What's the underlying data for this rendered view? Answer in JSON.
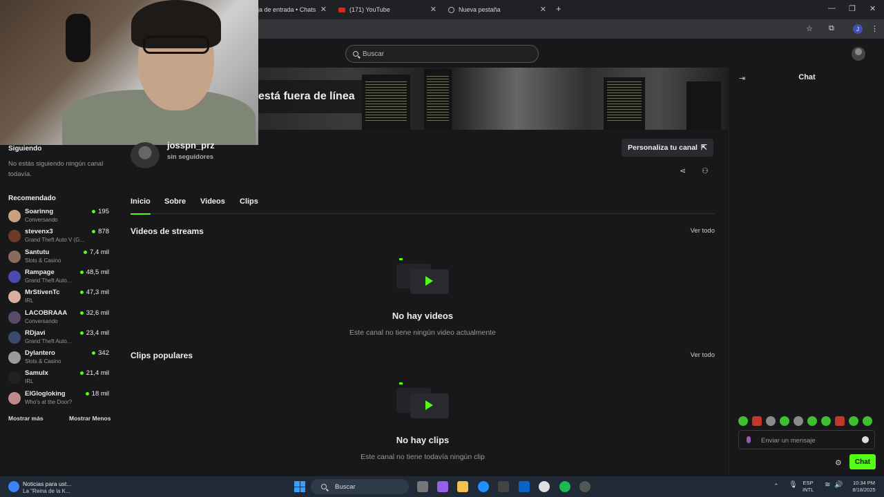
{
  "browser": {
    "tabs": [
      {
        "title": "ja de entrada • Chats"
      },
      {
        "title": "(171) YouTube"
      },
      {
        "title": "Nueva pestaña"
      }
    ],
    "tab_close": "✕",
    "new_tab": "+",
    "window_minimize": "—",
    "window_maximize": "❐",
    "window_close": "✕",
    "profile_initial": "J"
  },
  "header": {
    "search_placeholder": "Buscar"
  },
  "channel": {
    "offline_text": "está fuera de línea",
    "name": "josspn_prz",
    "followers": "sin seguidores",
    "customize_label": "Personaliza tu canal",
    "customize_icon": "⇱",
    "tabs": [
      {
        "label": "Inicio",
        "active": true
      },
      {
        "label": "Sobre"
      },
      {
        "label": "Videos"
      },
      {
        "label": "Clips"
      }
    ],
    "sections": [
      {
        "title": "Videos de streams",
        "link": "Ver todo",
        "empty_title": "No hay videos",
        "empty_sub": "Este canal no tiene ningún video actualmente"
      },
      {
        "title": "Clips populares",
        "link": "Ver todo",
        "empty_title": "No hay clips",
        "empty_sub": "Este canal no tiene todavía ningún clip"
      }
    ]
  },
  "sidebar": {
    "following_heading": "Siguiendo",
    "following_empty": "No estás siguiendo ningún canal todavía.",
    "recommended_heading": "Recomendado",
    "recommended": [
      {
        "name": "Soarinng",
        "category": "Conversando",
        "viewers": "195",
        "color": "#c9a080"
      },
      {
        "name": "stevenx3",
        "category": "Grand Theft Auto V (G...",
        "viewers": "878",
        "color": "#6b3a2a"
      },
      {
        "name": "Santutu",
        "category": "Slots & Casino",
        "viewers": "7,4 mil",
        "color": "#8a6a5a"
      },
      {
        "name": "Rampage",
        "category": "Grand Theft Auto...",
        "viewers": "48,5 mil",
        "color": "#4a4ab0"
      },
      {
        "name": "MrStivenTc",
        "category": "IRL",
        "viewers": "47,3 mil",
        "color": "#d9b0a0"
      },
      {
        "name": "LACOBRAAA",
        "category": "Conversando",
        "viewers": "32,6 mil",
        "color": "#5a4a6a"
      },
      {
        "name": "RDjavi",
        "category": "Grand Theft Auto...",
        "viewers": "23,4 mil",
        "color": "#3a4a6a"
      },
      {
        "name": "Dylantero",
        "category": "Slots & Casino",
        "viewers": "342",
        "color": "#9a9a9a"
      },
      {
        "name": "Samulx",
        "category": "IRL",
        "viewers": "21,4 mil",
        "color": "#222222"
      },
      {
        "name": "ElGlogloking",
        "category": "Who's at the Door?",
        "viewers": "18 mil",
        "color": "#c08a8a"
      }
    ],
    "show_more": "Mostrar más",
    "show_less": "Mostrar Menos"
  },
  "chat": {
    "title": "Chat",
    "input_placeholder": "Enviar un mensaje",
    "send_label": "Chat"
  },
  "taskbar": {
    "news_title": "Noticias para ust...",
    "news_sub": "La \"Reina de la K...",
    "search_label": "Buscar",
    "lang": "ESP",
    "lang_sub": "INTL",
    "time": "10:34 PM",
    "date": "8/18/2025"
  },
  "colors": {
    "accent": "#53fc18",
    "background": "#18181b"
  }
}
